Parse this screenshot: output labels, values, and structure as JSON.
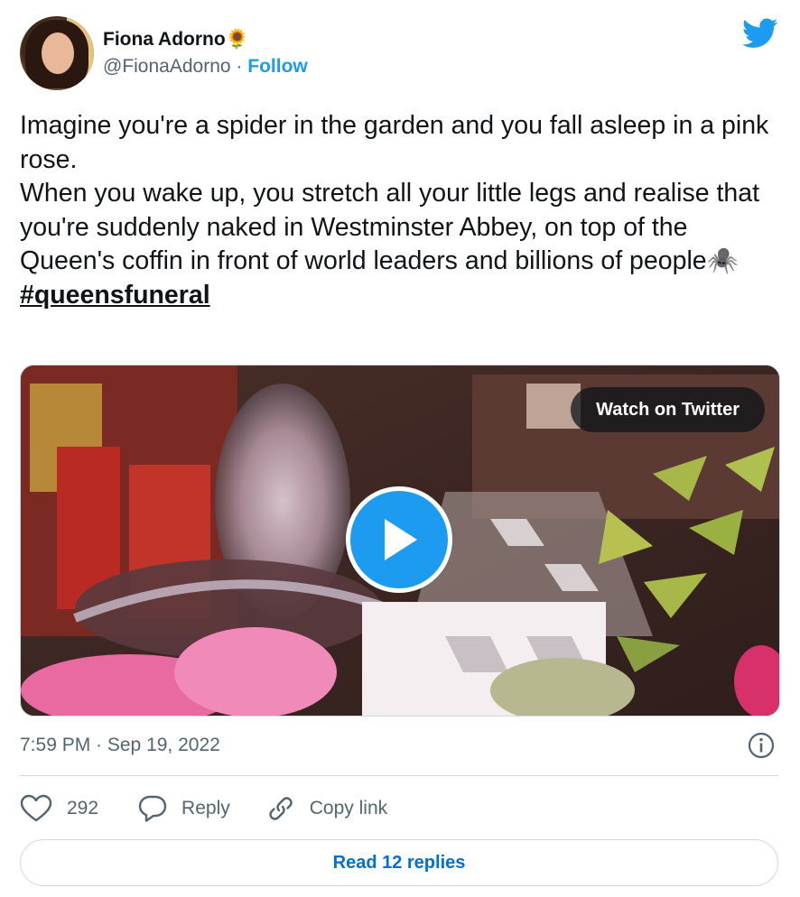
{
  "author": {
    "display_name": "Fiona Adorno🌻",
    "handle": "@FionaAdorno",
    "separator": " · ",
    "follow_label": "Follow"
  },
  "tweet": {
    "text": "Imagine you're a spider in the garden and you fall asleep in a pink rose.\nWhen you wake up, you stretch all your little legs and realise that you're suddenly naked in Westminster Abbey, on top of the Queen's coffin in front of world leaders and billions of people🕷️",
    "hashtag": "#queensfuneral"
  },
  "media": {
    "watch_label": "Watch on Twitter"
  },
  "meta": {
    "timestamp": "7:59 PM · Sep 19, 2022"
  },
  "actions": {
    "like_count": "292",
    "reply_label": "Reply",
    "copy_label": "Copy link"
  },
  "footer": {
    "read_replies_label": "Read 12 replies"
  },
  "colors": {
    "accent": "#1d9bf0",
    "link": "#006fd6",
    "secondary_text": "#536471",
    "border": "#cfd9de"
  },
  "icons": [
    "twitter-logo-icon",
    "play-icon",
    "info-icon",
    "heart-icon",
    "reply-icon",
    "link-icon"
  ]
}
